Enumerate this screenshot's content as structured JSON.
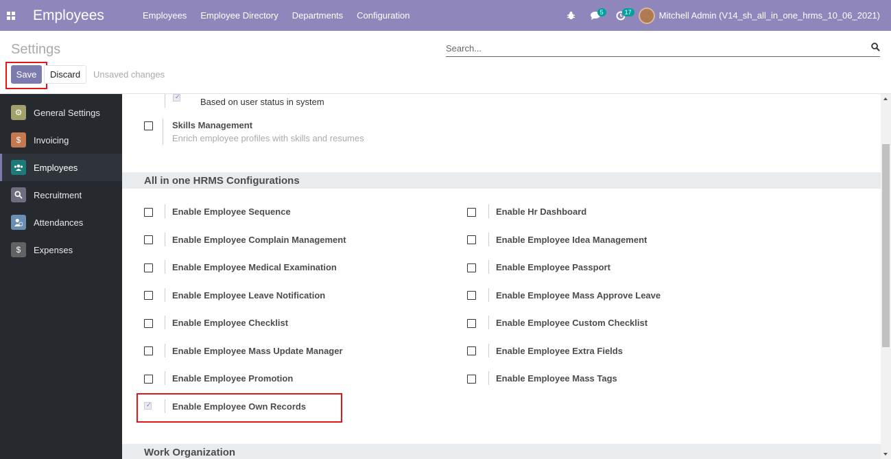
{
  "navbar": {
    "app_title": "Employees",
    "menu": [
      "Employees",
      "Employee Directory",
      "Departments",
      "Configuration"
    ],
    "messages_count": "5",
    "activities_count": "17",
    "user": "Mitchell Admin (V14_sh_all_in_one_hrms_10_06_2021)"
  },
  "control": {
    "title": "Settings",
    "search_placeholder": "Search...",
    "save": "Save",
    "discard": "Discard",
    "unsaved": "Unsaved changes"
  },
  "sidebar": {
    "items": [
      {
        "label": "General Settings",
        "color": "#a2a06b"
      },
      {
        "label": "Invoicing",
        "color": "#c47950"
      },
      {
        "label": "Employees",
        "color": "#1d7a7a"
      },
      {
        "label": "Recruitment",
        "color": "#6d6e80"
      },
      {
        "label": "Attendances",
        "color": "#6a8fb3"
      },
      {
        "label": "Expenses",
        "color": "#5f6363"
      }
    ]
  },
  "main": {
    "sub_option": "Based on user status in system",
    "skills": {
      "label": "Skills Management",
      "desc": "Enrich employee profiles with skills and resumes"
    },
    "section_hrms": "All in one HRMS Configurations",
    "left_options": [
      "Enable Employee Sequence",
      "Enable Employee Complain Management",
      "Enable Employee Medical Examination",
      "Enable Employee Leave Notification",
      "Enable Employee Checklist",
      "Enable Employee Mass Update Manager",
      "Enable Employee Promotion",
      "Enable Employee Own Records"
    ],
    "right_options": [
      "Enable Hr Dashboard",
      "Enable Employee Idea Management",
      "Enable Employee Passport",
      "Enable Employee Mass Approve Leave",
      "Enable Employee Custom Checklist",
      "Enable Employee Extra Fields",
      "Enable Employee Mass Tags"
    ],
    "section_work": "Work Organization"
  }
}
